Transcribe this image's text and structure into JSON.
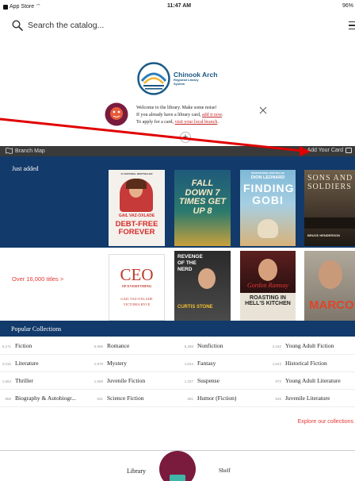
{
  "status_bar": {
    "back_app": "App Store",
    "time": "11:47 AM",
    "battery": "96%"
  },
  "search": {
    "placeholder": "Search the catalog..."
  },
  "logo": {
    "title": "Chinook Arch",
    "subtitle_line1": "Regional Library",
    "subtitle_line2": "System"
  },
  "welcome": {
    "line1": "Welcome to the library. Make some noise!",
    "line2_prefix": "If you already have a library card, ",
    "line2_link": "add it now",
    "line2_suffix": ".",
    "line3_prefix": "To apply for a card, ",
    "line3_link": "visit your local branch",
    "line3_suffix": "."
  },
  "branch_bar": {
    "branch_map": "Branch Map",
    "add_card": "Add Your Card"
  },
  "just_added": {
    "title": "Just added",
    "titles_link": "Over 16,000 titles >"
  },
  "books": [
    {
      "top_line": "#1 NATIONAL BESTSELLER",
      "title": "DEBT-FREE FOREVER",
      "author": "GAIL VAZ-OXLADE"
    },
    {
      "title": "FALL DOWN 7 TIMES GET UP 8"
    },
    {
      "top_line": "INTERNATIONAL BESTSELLER",
      "author": "DION LEONARD",
      "title": "FINDING GOBI"
    },
    {
      "title": "SONS AND SOLDIERS",
      "author": "BRUCE HENDERSON"
    },
    {
      "title": "CEO",
      "subtitle": "OF EVERYTHING",
      "author": "GAIL VAZ-OXLADE",
      "author2": "VICTORIA RYCE"
    },
    {
      "title": "REVENGE OF THE NERD",
      "author": "CURTIS STONE"
    },
    {
      "author": "Gordon Ramsay",
      "title": "ROASTING IN HELL'S KITCHEN"
    },
    {
      "title": "MARCO"
    }
  ],
  "popular": {
    "title": "Popular Collections",
    "rows": [
      [
        {
          "count": "6,171",
          "name": "Fiction"
        },
        {
          "count": "5,966",
          "name": "Romance"
        },
        {
          "count": "5,259",
          "name": "Nonfiction"
        },
        {
          "count": "2,152",
          "name": "Young Adult Fiction"
        }
      ],
      [
        {
          "count": "2,015",
          "name": "Literature"
        },
        {
          "count": "1,978",
          "name": "Mystery"
        },
        {
          "count": "1,644",
          "name": "Fantasy"
        },
        {
          "count": "1,643",
          "name": "Historical Fiction"
        }
      ],
      [
        {
          "count": "1,564",
          "name": "Thriller"
        },
        {
          "count": "1,558",
          "name": "Juvenile Fiction"
        },
        {
          "count": "1,337",
          "name": "Suspense"
        },
        {
          "count": "972",
          "name": "Young Adult Literature"
        }
      ],
      [
        {
          "count": "858",
          "name": "Biography & Autobiogr..."
        },
        {
          "count": "831",
          "name": "Science Fiction"
        },
        {
          "count": "581",
          "name": "Humor (Fiction)"
        },
        {
          "count": "526",
          "name": "Juvenile Literature"
        }
      ]
    ],
    "explore": "Explore our collections"
  },
  "bottom_nav": {
    "library": "Library",
    "shelf": "Shelf"
  },
  "colors": {
    "navy": "#123a6a",
    "accent_red": "#e53935",
    "dark_bar": "#3a3a3a",
    "shelf_maroon": "#7a1b3e"
  }
}
